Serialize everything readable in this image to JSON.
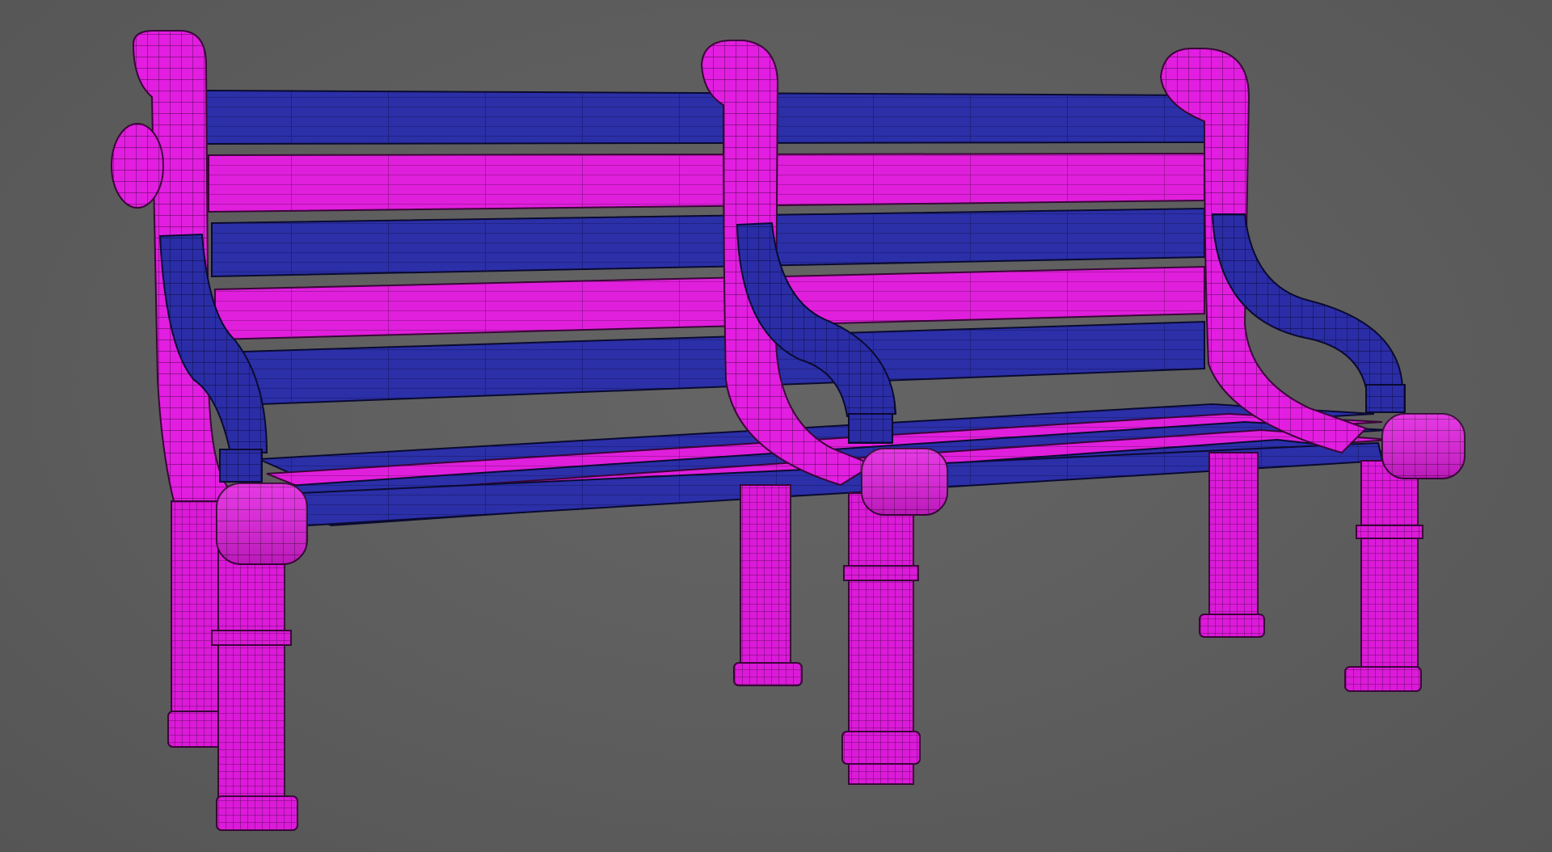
{
  "viewport": {
    "description_visible_text": "",
    "background_color": "#5d5d5d"
  },
  "model": {
    "subject": "park-bench-wireframe",
    "colors": {
      "primary_part": "#e21ee0",
      "secondary_part": "#2a2da6",
      "wire": "#1a0a22",
      "background": "#5d5d5d"
    },
    "parts": {
      "back_slats": 5,
      "seat_slats": 6,
      "side_frames": 3,
      "armrests": 3,
      "legs": 6
    }
  }
}
